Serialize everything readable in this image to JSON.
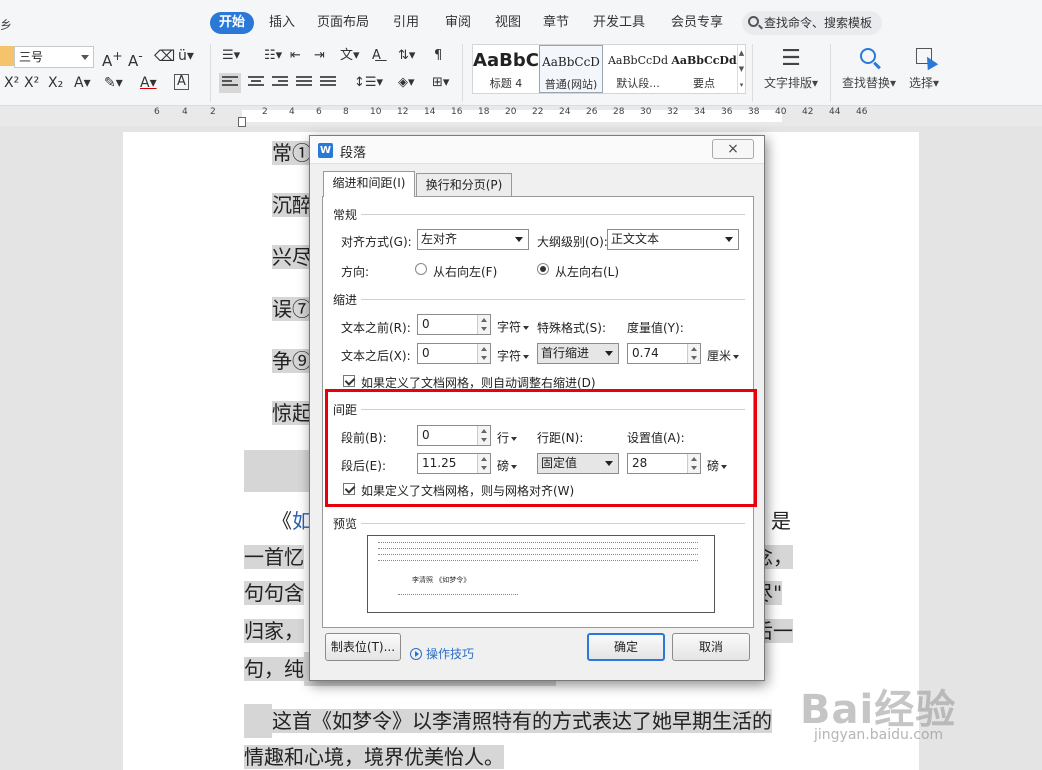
{
  "ribbon": {
    "tabs": [
      "开始",
      "插入",
      "页面布局",
      "引用",
      "审阅",
      "视图",
      "章节",
      "开发工具",
      "会员专享"
    ],
    "active_tab": "开始",
    "search_placeholder": "查找命令、搜索模板",
    "left_cut_label": "乡",
    "font_size": "三号",
    "styles": [
      {
        "preview": "AaBbC",
        "name": "标题 4"
      },
      {
        "preview": "AaBbCcD",
        "name": "普通(网站)"
      },
      {
        "preview": "AaBbCcDd",
        "name": "默认段..."
      },
      {
        "preview": "AaBbCcDd",
        "name": "要点"
      }
    ],
    "text_layout_label": "文字排版",
    "find_replace_label": "查找替换",
    "select_label": "选择"
  },
  "ruler": {
    "left_ticks": [
      "6",
      "4",
      "2"
    ],
    "ticks": [
      "2",
      "4",
      "6",
      "8",
      "10",
      "12",
      "14",
      "16",
      "18",
      "20",
      "22",
      "24",
      "26",
      "28",
      "30",
      "32",
      "34",
      "36",
      "38",
      "40",
      "42",
      "44",
      "46"
    ]
  },
  "document": {
    "lines_left": [
      "常①",
      "沉醉",
      "兴尽",
      "误⑦",
      "争⑨",
      "惊起"
    ],
    "para2_line1_prefix": "《",
    "para2_line1_link": "如",
    "para2_line1_end": "是",
    "para2_line2_start": "一首忆",
    "para2_line2_end": "念，",
    "para2_line3_start": "句句含",
    "para2_line3_end": "尽\"",
    "para2_line4_start": "归家，",
    "para2_line4_end": "后一",
    "para2_line5_start": "句，纯",
    "para3_line1": "这首《如梦令》以李清照特有的方式表达了她早期生活的",
    "para3_line2": "情趣和心境，境界优美怡人。"
  },
  "dialog": {
    "title": "段落",
    "close": "×",
    "tabs": [
      "缩进和间距(I)",
      "换行和分页(P)"
    ],
    "general": {
      "section": "常规",
      "align_label": "对齐方式(G):",
      "align_value": "左对齐",
      "outline_label": "大纲级别(O):",
      "outline_value": "正文文本",
      "direction_label": "方向:",
      "rtl_label": "从右向左(F)",
      "ltr_label": "从左向右(L)"
    },
    "indent": {
      "section": "缩进",
      "before_label": "文本之前(R):",
      "before_value": "0",
      "before_unit": "字符",
      "after_label": "文本之后(X):",
      "after_value": "0",
      "after_unit": "字符",
      "special_label": "特殊格式(S):",
      "special_value": "首行缩进",
      "measure_label": "度量值(Y):",
      "measure_value": "0.74",
      "measure_unit": "厘米",
      "auto_adjust_label": "如果定义了文档网格，则自动调整右缩进(D)"
    },
    "spacing": {
      "section": "间距",
      "before_label": "段前(B):",
      "before_value": "0",
      "before_unit": "行",
      "after_label": "段后(E):",
      "after_value": "11.25",
      "after_unit": "磅",
      "line_label": "行距(N):",
      "line_value": "固定值",
      "set_label": "设置值(A):",
      "set_value": "28",
      "set_unit": "磅",
      "grid_align_label": "如果定义了文档网格，则与网格对齐(W)"
    },
    "preview": {
      "section": "预览",
      "sample_text": "李清照 《如梦令》"
    },
    "buttons": {
      "tabs": "制表位(T)...",
      "tips": "操作技巧",
      "ok": "确定",
      "cancel": "取消"
    }
  },
  "watermark": {
    "logo": "Bai经验",
    "url": "jingyan.baidu.com"
  }
}
